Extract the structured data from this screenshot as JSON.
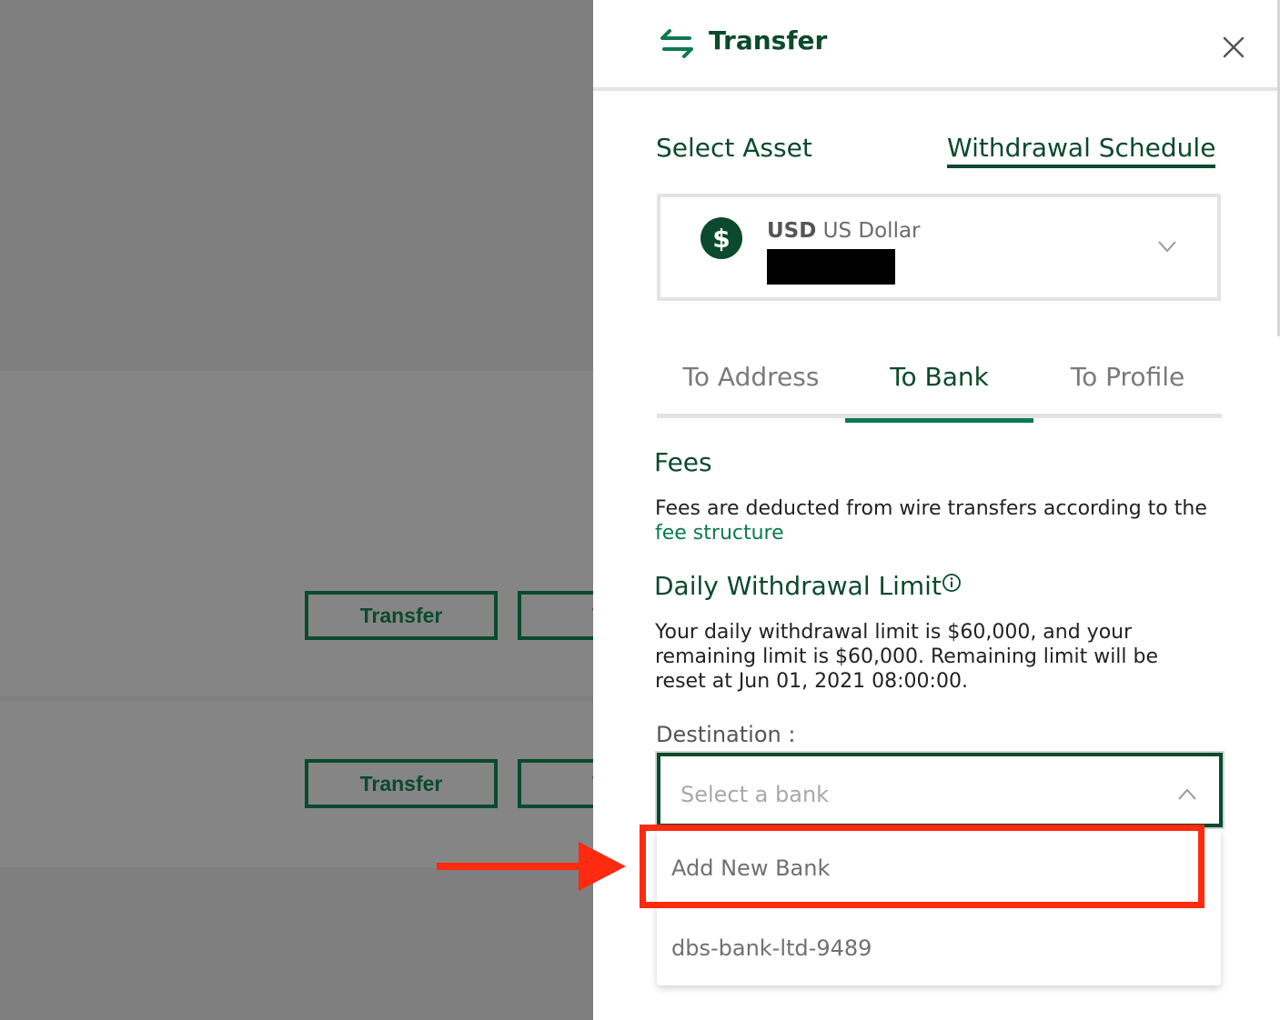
{
  "background": {
    "buttons": [
      {
        "label": "Transfer"
      },
      {
        "label": "T"
      },
      {
        "label": "Transfer"
      },
      {
        "label": "T"
      }
    ]
  },
  "drawer": {
    "title": "Transfer",
    "header_icon": "transfer-arrows-icon",
    "close_icon": "close-icon",
    "select_asset_label": "Select Asset",
    "withdrawal_schedule_link": "Withdrawal Schedule",
    "asset": {
      "symbol_glyph": "$",
      "code": "USD",
      "name": "US Dollar",
      "balance_redacted": true
    },
    "tabs": [
      {
        "label": "To Address",
        "active": false
      },
      {
        "label": "To Bank",
        "active": true
      },
      {
        "label": "To Profile",
        "active": false
      }
    ],
    "fees": {
      "title": "Fees",
      "text": "Fees are deducted from wire transfers according to the",
      "link": "fee structure"
    },
    "limit": {
      "title": "Daily Withdrawal Limit",
      "text": "Your daily withdrawal limit is $60,000, and your remaining limit is $60,000. Remaining limit will be reset at Jun 01, 2021 08:00:00."
    },
    "destination": {
      "label": "Destination :",
      "placeholder": "Select a bank",
      "options": [
        {
          "label": "Add New Bank"
        },
        {
          "label": "dbs-bank-ltd-9489"
        }
      ]
    }
  },
  "colors": {
    "brand_dark_green": "#0b4a2c",
    "brand_green": "#0b7a4e",
    "annotation_red": "#ff2a10"
  }
}
